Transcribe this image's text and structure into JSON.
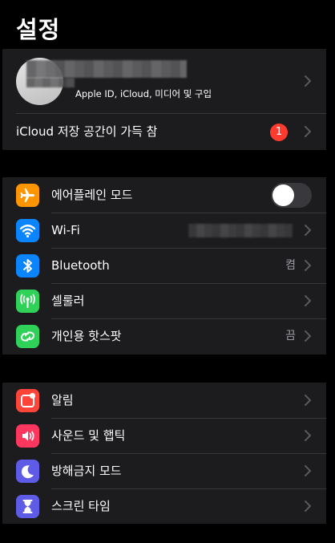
{
  "header": {
    "title": "설정"
  },
  "profile": {
    "subtitle": "Apple ID, iCloud, 미디어 및 구입",
    "avatar_initials": "",
    "storage_alert_label": "iCloud 저장 공간이 가득 참",
    "storage_alert_badge": "1"
  },
  "connectivity": {
    "items": [
      {
        "label": "에어플레인 모드",
        "icon": "airplane-icon",
        "color": "#ff9500",
        "toggle_on": false
      },
      {
        "label": "Wi-Fi",
        "icon": "wifi-icon",
        "color": "#0a84ff",
        "value": ""
      },
      {
        "label": "Bluetooth",
        "icon": "bluetooth-icon",
        "color": "#0a84ff",
        "value": "켬"
      },
      {
        "label": "셀룰러",
        "icon": "cellular-icon",
        "color": "#30d158"
      },
      {
        "label": "개인용 핫스팟",
        "icon": "hotspot-icon",
        "color": "#30d158",
        "value": "끔"
      }
    ]
  },
  "notifications": {
    "items": [
      {
        "label": "알림",
        "icon": "notifications-icon",
        "color": "#ff453a"
      },
      {
        "label": "사운드 및 햅틱",
        "icon": "sound-icon",
        "color": "#ff375f"
      },
      {
        "label": "방해금지 모드",
        "icon": "moon-icon",
        "color": "#5e5ce6"
      },
      {
        "label": "스크린 타임",
        "icon": "hourglass-icon",
        "color": "#5e5ce6"
      }
    ]
  },
  "colors": {
    "background": "#000000",
    "group_background": "#1c1c1e",
    "separator": "#38383a",
    "secondary_text": "#98989e",
    "badge": "#ff3b30"
  }
}
